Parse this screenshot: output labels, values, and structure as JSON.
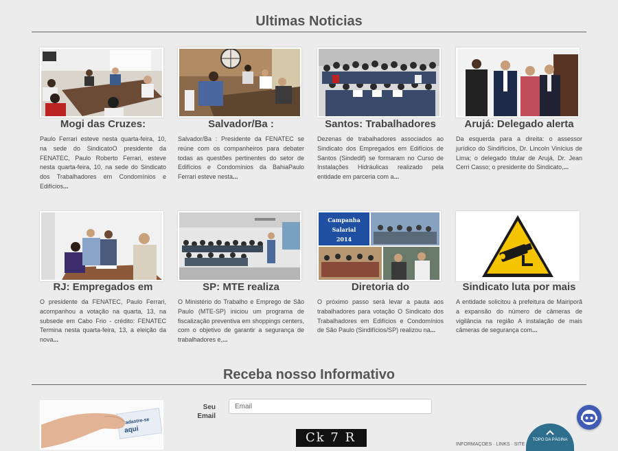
{
  "news_section": {
    "title": "Ultimas Noticias"
  },
  "news": [
    {
      "title": "Mogi das Cruzes:",
      "text": "Paulo Ferrari esteve nesta quarta-feira, 10, na sede do SindicatoO presidente da FENATEC, Paulo Roberto Ferrari, esteve nesta quarta-feira, 10, na sede do Sindicato dos Trabalhadores em Condomínios e Edifícios",
      "more": "..."
    },
    {
      "title": "Salvador/Ba :",
      "text": "Salvador/Ba : Presidente da FENATEC se reúne com os companheiros para debater todas as questões pertinentes do setor de Edifícios e Condomínios da BahiaPaulo Ferrari esteve nesta",
      "more": "..."
    },
    {
      "title": "Santos: Trabalhadores",
      "text": "Dezenas de trabalhadores associados ao Sindicato dos Empregados em Edifícios de Santos (Sindedif) se formaram no Curso de Instalações Hidráulicas realizado pela entidade em parceria com a",
      "more": "..."
    },
    {
      "title": "Arujá: Delegado alerta",
      "text": "Da esquerda para a direita: o assessor jurídico do Sindifícios, Dr. Lincoln Vinícius de Lima; o delegado titular de Arujá, Dr. Jean Cerri Casso; o presidente do Sindicato,",
      "more": "..."
    },
    {
      "title": "RJ: Empregados em",
      "text": "O presidente da FENATEC, Paulo Ferrari, acompanhou a votação na quarta, 13, na subsede em Cabo Frio - crédito: FENATEC Termina nesta quarta-feira, 13, a eleição da nova",
      "more": "..."
    },
    {
      "title": "SP: MTE realiza",
      "text": "O Ministério do Trabalho e Emprego de São Paulo (MTE-SP) iniciou um programa de fiscalização preventiva em shoppings centers, com o objetivo de garantir a segurança de trabalhadores e,",
      "more": "..."
    },
    {
      "title": "Diretoria do",
      "text": "O próximo passo será levar a pauta aos trabalhadores para votação O Sindicato dos Trabalhadores em Edifícios e Condomínios de São Paulo (Sindifícios/SP) realizou na",
      "more": "..."
    },
    {
      "title": "Sindicato luta por mais",
      "text": "A entidade solicitou à prefeitura de Mairiporã a expansão do número de câmeras de vigilância na região A instalação de mais câmeras de segurança com",
      "more": "..."
    }
  ],
  "campaign_badge": {
    "line1": "Campanha",
    "line2": "Salarial",
    "line3": "2014"
  },
  "newsletter": {
    "title": "Receba nosso Informativo",
    "card_text_1": "Cadastre-se",
    "card_text_2": "aqui",
    "email_label": "Seu Email",
    "email_placeholder": "Email",
    "captcha_text": "Ck 7 R"
  },
  "back_to_top": {
    "label": "TOPO DA PÁGINA",
    "icon": "chevron-up-icon"
  },
  "chat": {
    "icon": "chat-robot-icon",
    "color": "#3f5bb4"
  },
  "footer_partial": "INFORMAÇÕES · LINKS · SITE · MAPA",
  "colors": {
    "background": "#ececec",
    "accent": "#2e6f8e",
    "warning_sign": "#f5c400"
  }
}
